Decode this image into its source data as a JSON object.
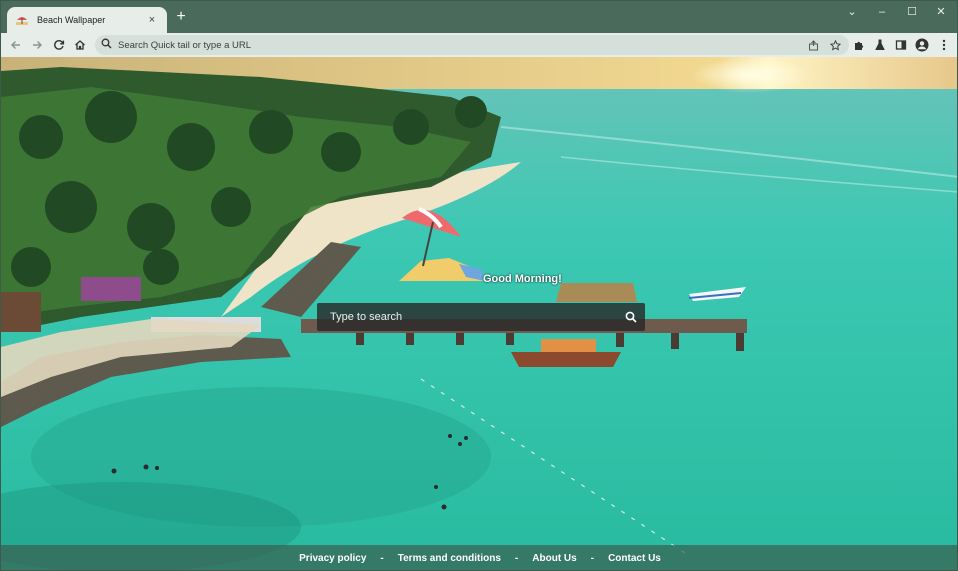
{
  "tab": {
    "title": "Beach Wallpaper",
    "close_glyph": "×",
    "new_tab_glyph": "+"
  },
  "window_controls": {
    "menu": "⌄",
    "minimize": "–",
    "maximize": "☐",
    "close": "✕"
  },
  "omnibox": {
    "placeholder": "Search Quick tail or type a URL"
  },
  "page": {
    "greeting": "Good Morning!",
    "search_placeholder": "Type to search",
    "footer": {
      "privacy": "Privacy policy",
      "terms": "Terms and conditions",
      "about": "About Us",
      "contact": "Contact Us",
      "separator": "-"
    }
  },
  "colors": {
    "frame": "#4a6b5c",
    "toolbar": "#e7ede9",
    "sea": "#2fbfa8",
    "footer_bar": "#3a6050"
  }
}
